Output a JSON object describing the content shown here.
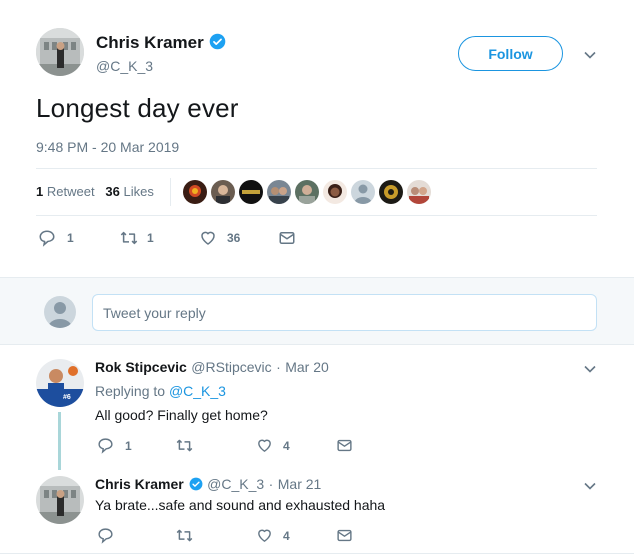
{
  "tweet": {
    "author_name": "Chris Kramer",
    "handle": "@C_K_3",
    "follow_label": "Follow",
    "text": "Longest day ever",
    "timestamp": "9:48 PM - 20 Mar 2019",
    "retweet_count": "1",
    "retweet_label": "Retweet",
    "like_count": "36",
    "like_label": "Likes",
    "actions": {
      "reply_count": "1",
      "retweet_count": "1",
      "like_count": "36"
    }
  },
  "likers": [
    {
      "icon": "liker-avatar-1"
    },
    {
      "icon": "liker-avatar-2"
    },
    {
      "icon": "liker-avatar-3"
    },
    {
      "icon": "liker-avatar-4"
    },
    {
      "icon": "liker-avatar-5"
    },
    {
      "icon": "liker-avatar-6"
    },
    {
      "icon": "liker-avatar-7"
    },
    {
      "icon": "liker-avatar-8"
    },
    {
      "icon": "liker-avatar-9"
    }
  ],
  "reply_box": {
    "placeholder": "Tweet your reply"
  },
  "replies": [
    {
      "author_name": "Rok Stipcevic",
      "handle": "@RStipcevic",
      "separator": "·",
      "date": "Mar 20",
      "replying_to_label": "Replying to",
      "replying_to_handle": "@C_K_3",
      "text": "All good? Finally get home?",
      "reply_count": "1",
      "retweet_count": "",
      "like_count": "4"
    },
    {
      "author_name": "Chris Kramer",
      "handle": "@C_K_3",
      "separator": "·",
      "date": "Mar 21",
      "text": "Ya brate...safe and sound and exhausted haha",
      "reply_count": "",
      "retweet_count": "",
      "like_count": "4"
    }
  ],
  "colors": {
    "accent": "#1b95e0",
    "text": "#14171a",
    "muted": "#657786",
    "divider": "#e6ecf0",
    "thread": "#a9d6d9"
  }
}
